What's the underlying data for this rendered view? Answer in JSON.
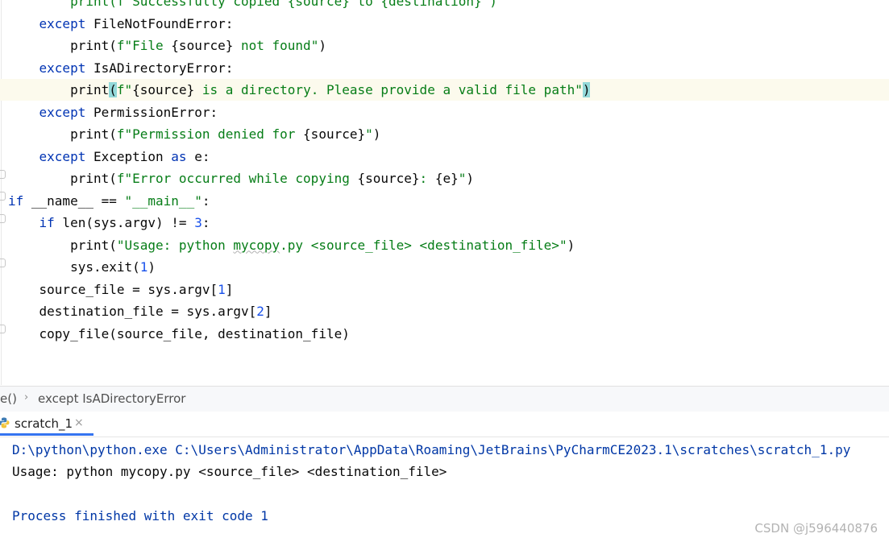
{
  "editor": {
    "lines": [
      {
        "indent": "        ",
        "parts": [
          {
            "t": "print(f\"Successfully copied {source} to {destination}\")",
            "c": "mixed-top"
          }
        ]
      },
      {
        "indent": "    ",
        "parts": [
          {
            "t": "except",
            "c": "kw"
          },
          {
            "t": " FileNotFoundError:",
            "c": ""
          }
        ]
      },
      {
        "indent": "        ",
        "parts": [
          {
            "t": "print(",
            "c": ""
          },
          {
            "t": "f\"File ",
            "c": "str"
          },
          {
            "t": "{source}",
            "c": ""
          },
          {
            "t": " not found\"",
            "c": "str"
          },
          {
            "t": ")",
            "c": ""
          }
        ]
      },
      {
        "indent": "    ",
        "parts": [
          {
            "t": "except",
            "c": "kw"
          },
          {
            "t": " IsADirectoryError:",
            "c": ""
          }
        ]
      },
      {
        "indent": "        ",
        "current": true,
        "parts": [
          {
            "t": "print",
            "c": ""
          },
          {
            "t": "(",
            "c": "brace"
          },
          {
            "t": "f\"",
            "c": "str"
          },
          {
            "t": "{source}",
            "c": ""
          },
          {
            "t": " is a directory. Please provide a valid file path\"",
            "c": "str"
          },
          {
            "t": ")",
            "c": "brace"
          }
        ]
      },
      {
        "indent": "    ",
        "parts": [
          {
            "t": "except",
            "c": "kw"
          },
          {
            "t": " PermissionError:",
            "c": ""
          }
        ]
      },
      {
        "indent": "        ",
        "parts": [
          {
            "t": "print(",
            "c": ""
          },
          {
            "t": "f\"Permission denied for ",
            "c": "str"
          },
          {
            "t": "{source}",
            "c": ""
          },
          {
            "t": "\"",
            "c": "str"
          },
          {
            "t": ")",
            "c": ""
          }
        ]
      },
      {
        "indent": "    ",
        "parts": [
          {
            "t": "except",
            "c": "kw"
          },
          {
            "t": " Exception ",
            "c": ""
          },
          {
            "t": "as",
            "c": "kw"
          },
          {
            "t": " e:",
            "c": ""
          }
        ]
      },
      {
        "indent": "        ",
        "parts": [
          {
            "t": "print(",
            "c": ""
          },
          {
            "t": "f\"Error occurred while copying ",
            "c": "str"
          },
          {
            "t": "{source}",
            "c": ""
          },
          {
            "t": ": ",
            "c": "str"
          },
          {
            "t": "{e}",
            "c": ""
          },
          {
            "t": "\"",
            "c": "str"
          },
          {
            "t": ")",
            "c": ""
          }
        ]
      },
      {
        "indent": "",
        "parts": [
          {
            "t": "if",
            "c": "kw"
          },
          {
            "t": " __name__ == ",
            "c": ""
          },
          {
            "t": "\"__main__\"",
            "c": "str"
          },
          {
            "t": ":",
            "c": ""
          }
        ]
      },
      {
        "indent": "    ",
        "parts": [
          {
            "t": "if",
            "c": "kw"
          },
          {
            "t": " len(sys.argv) != ",
            "c": ""
          },
          {
            "t": "3",
            "c": "num"
          },
          {
            "t": ":",
            "c": ""
          }
        ]
      },
      {
        "indent": "        ",
        "parts": [
          {
            "t": "print(",
            "c": ""
          },
          {
            "t": "\"Usage: python ",
            "c": "str"
          },
          {
            "t": "mycopy",
            "c": "str wavy"
          },
          {
            "t": ".py <source_file> <destination_file>\"",
            "c": "str"
          },
          {
            "t": ")",
            "c": ""
          }
        ]
      },
      {
        "indent": "        ",
        "parts": [
          {
            "t": "sys.exit(",
            "c": ""
          },
          {
            "t": "1",
            "c": "num"
          },
          {
            "t": ")",
            "c": ""
          }
        ]
      },
      {
        "indent": "    ",
        "parts": [
          {
            "t": "source_file = sys.argv[",
            "c": ""
          },
          {
            "t": "1",
            "c": "num"
          },
          {
            "t": "]",
            "c": ""
          }
        ]
      },
      {
        "indent": "    ",
        "parts": [
          {
            "t": "destination_file = sys.argv[",
            "c": ""
          },
          {
            "t": "2",
            "c": "num"
          },
          {
            "t": "]",
            "c": ""
          }
        ]
      },
      {
        "indent": "    ",
        "parts": [
          {
            "t": "copy_file(source_file, destination_file)",
            "c": ""
          }
        ]
      }
    ]
  },
  "breadcrumb": {
    "item1": "e()",
    "separator": "›",
    "item2": "except IsADirectoryError"
  },
  "run_tab": {
    "label": "scratch_1",
    "close": "×"
  },
  "console": {
    "command": "D:\\python\\python.exe C:\\Users\\Administrator\\AppData\\Roaming\\JetBrains\\PyCharmCE2023.1\\scratches\\scratch_1.py",
    "output": "Usage: python mycopy.py <source_file> <destination_file>",
    "exit_message": "Process finished with exit code 1"
  },
  "watermark": "CSDN @j596440876",
  "colors": {
    "keyword": "#0033b3",
    "string": "#067d17",
    "number": "#1750eb",
    "brace_match": "#93d9d9",
    "current_line": "#fcfaed",
    "tab_underline": "#3574f0"
  }
}
